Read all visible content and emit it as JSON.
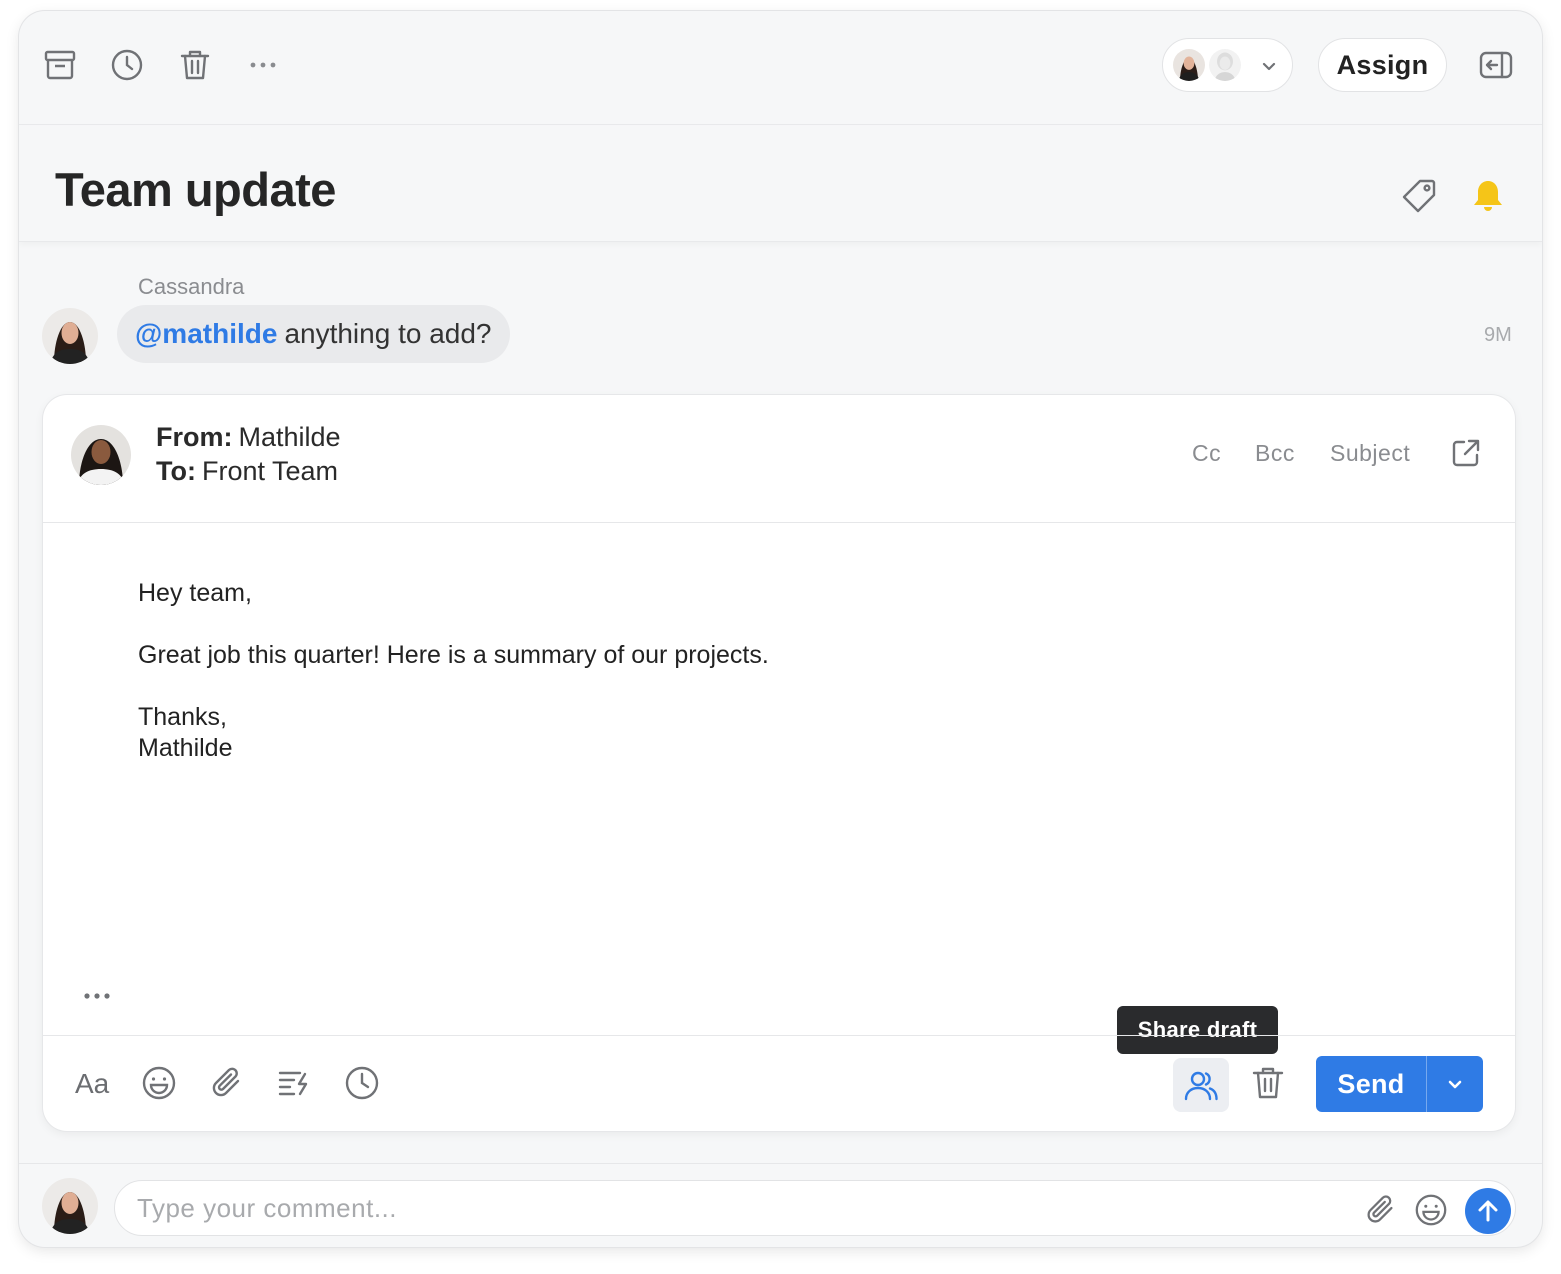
{
  "toolbar": {
    "assign_label": "Assign",
    "icons": [
      "archive-icon",
      "clock-icon",
      "trash-icon",
      "more-icon",
      "chevron-down-icon",
      "exit-conversation-icon"
    ]
  },
  "conversation": {
    "title": "Team update"
  },
  "comment": {
    "author": "Cassandra",
    "mention": "@mathilde",
    "text": "anything to add?",
    "time": "9M"
  },
  "draft": {
    "from_label": "From:",
    "from_value": "Mathilde",
    "to_label": "To:",
    "to_value": "Front Team",
    "cc_label": "Cc",
    "bcc_label": "Bcc",
    "subject_label": "Subject",
    "body": {
      "greeting": "Hey team,",
      "line1": "Great job this quarter! Here is a summary of our projects.",
      "signoff": "Thanks,",
      "signature": "Mathilde"
    },
    "format_label": "Aa",
    "tooltip": "Share draft",
    "send_label": "Send"
  },
  "composer": {
    "placeholder": "Type your comment..."
  },
  "colors": {
    "accent": "#2f7be5",
    "bell": "#f5c518",
    "background": "#f6f7f8"
  }
}
